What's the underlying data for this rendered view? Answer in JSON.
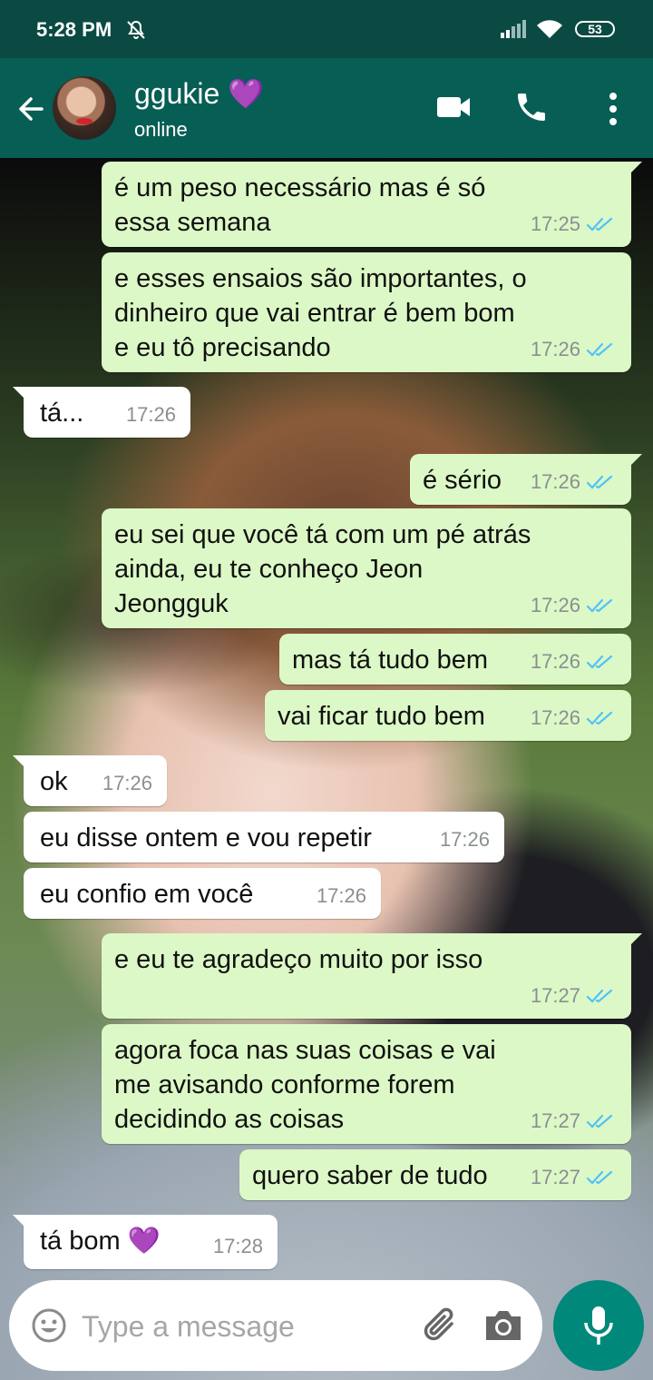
{
  "status_bar": {
    "time": "5:28 PM",
    "battery": "53"
  },
  "header": {
    "contact_name": "ggukie 💜",
    "contact_status": "online",
    "icons": [
      "back-arrow-icon",
      "video-call-icon",
      "voice-call-icon",
      "more-options-icon"
    ]
  },
  "messages": [
    {
      "dir": "out",
      "text": "é um peso necessário mas é só essa semana",
      "time": "17:25",
      "ticks": "read"
    },
    {
      "dir": "out",
      "text": "e esses ensaios são importantes, o dinheiro que vai entrar é bem bom e eu tô precisando",
      "time": "17:26",
      "ticks": "read"
    },
    {
      "dir": "in",
      "text": "tá...",
      "time": "17:26"
    },
    {
      "dir": "out",
      "text": "é sério",
      "time": "17:26",
      "ticks": "read"
    },
    {
      "dir": "out",
      "text": "eu sei que você tá com um pé atrás ainda, eu te conheço Jeon Jeongguk",
      "time": "17:26",
      "ticks": "read"
    },
    {
      "dir": "out",
      "text": "mas tá tudo bem",
      "time": "17:26",
      "ticks": "read"
    },
    {
      "dir": "out",
      "text": "vai ficar tudo bem",
      "time": "17:26",
      "ticks": "read"
    },
    {
      "dir": "in",
      "text": "ok",
      "time": "17:26"
    },
    {
      "dir": "in",
      "text": "eu disse ontem e vou repetir",
      "time": "17:26"
    },
    {
      "dir": "in",
      "text": "eu confio em você",
      "time": "17:26"
    },
    {
      "dir": "out",
      "text": "e eu te agradeço muito por isso",
      "time": "17:27",
      "ticks": "read"
    },
    {
      "dir": "out",
      "text": "agora foca nas suas coisas e vai me avisando conforme forem decidindo as coisas",
      "time": "17:27",
      "ticks": "read"
    },
    {
      "dir": "out",
      "text": "quero saber de tudo",
      "time": "17:27",
      "ticks": "read"
    },
    {
      "dir": "in",
      "text": "tá bom 💜",
      "time": "17:28"
    }
  ],
  "composer": {
    "placeholder": "Type a message"
  },
  "colors": {
    "header": "#075e54",
    "outgoing_bubble": "#dcf8c6",
    "incoming_bubble": "#ffffff",
    "read_ticks": "#4fc3f7",
    "mic_button": "#00897b"
  }
}
